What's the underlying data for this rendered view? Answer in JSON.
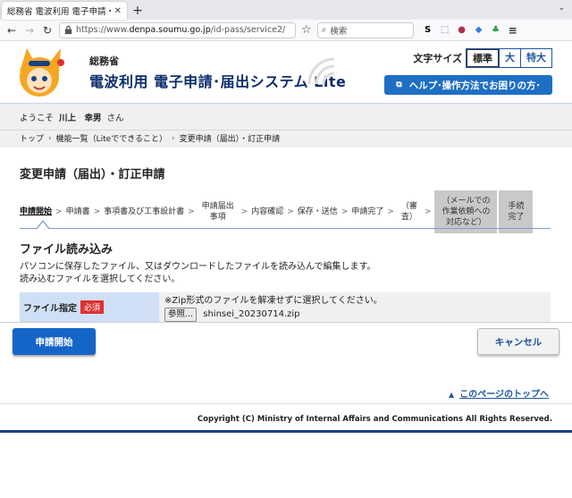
{
  "browser": {
    "tab_title": "総務省 電波利用 電子申請・届",
    "url_prefix": "https://www.",
    "url_domain": "denpa.soumu.go.jp",
    "url_path": "/id-pass/service2/",
    "search_placeholder": "検索",
    "ext_s": "S"
  },
  "header": {
    "ministry": "総務省",
    "system_title": "電波利用 電子申請･届出システム Lite",
    "font_size_label": "文字サイズ",
    "font_sizes": [
      "標準",
      "大",
      "特大"
    ],
    "help_label": "ヘルプ･操作方法でお困りの方･"
  },
  "welcome": {
    "prefix": "ようこそ",
    "user_name": "川上　幸男",
    "suffix": "さん"
  },
  "breadcrumb": [
    "トップ",
    "機能一覧（Liteでできること）",
    "変更申請（届出）・訂正申請"
  ],
  "main": {
    "title": "変更申請（届出）・訂正申請",
    "steps": [
      "申請開始",
      "申請書",
      "事項書及び工事設計書",
      "申請届出事項",
      "内容確認",
      "保存・送信",
      "申請完了",
      "（審査）",
      "（メールでの作業依頼への対応など）",
      "手続完了"
    ],
    "section_title": "ファイル読み込み",
    "desc_line1": "パソコンに保存したファイル、又はダウンロードしたファイルを読み込んで編集します。",
    "desc_line2": "読み込むファイルを選択してください。",
    "file_label": "ファイル指定",
    "required_badge": "必須",
    "file_note": "※Zip形式のファイルを解凍せずに選択してください。",
    "browse_label": "参照...",
    "file_name": "shinsei_20230714.zip"
  },
  "actions": {
    "start_label": "申請開始",
    "cancel_label": "キャンセル"
  },
  "footer": {
    "to_top": "このページのトップへ",
    "copyright": "Copyright (C) Ministry of Internal Affairs and Communications All Rights Reserved."
  },
  "colors": {
    "primary": "#1565c8",
    "navy": "#0c2d6b",
    "required": "#e03030",
    "label_bg": "#cfe0f6"
  }
}
